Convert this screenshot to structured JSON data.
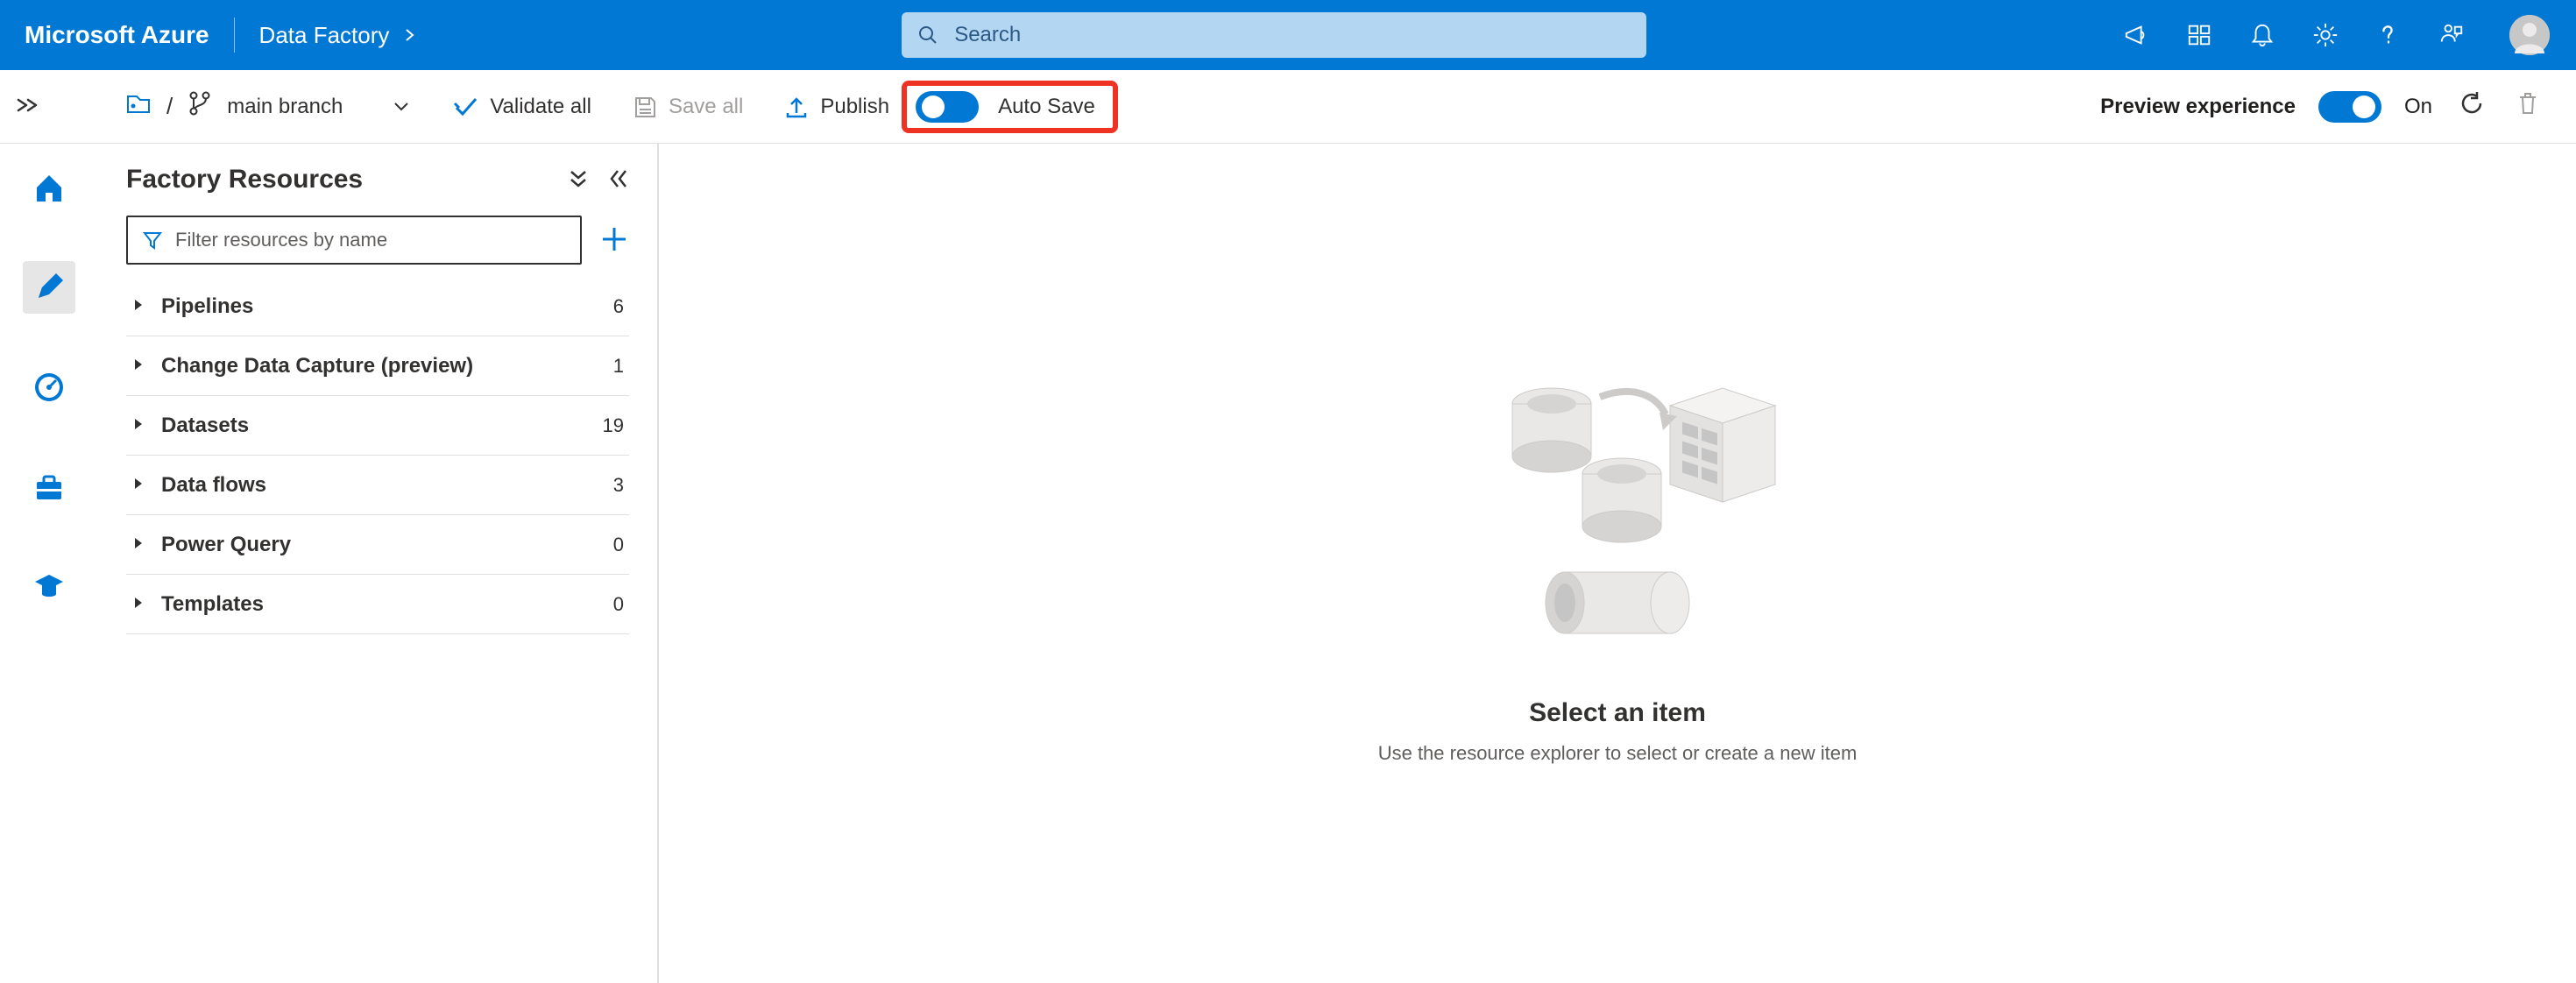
{
  "topbar": {
    "brand": "Microsoft Azure",
    "service": "Data Factory",
    "search_placeholder": "Search"
  },
  "toolbar": {
    "branch_name": "main branch",
    "validate_all": "Validate all",
    "save_all": "Save all",
    "publish": "Publish",
    "auto_save": "Auto Save",
    "preview_experience": "Preview experience",
    "preview_on": "On"
  },
  "resources": {
    "title": "Factory Resources",
    "filter_placeholder": "Filter resources by name",
    "items": [
      {
        "label": "Pipelines",
        "count": "6"
      },
      {
        "label": "Change Data Capture (preview)",
        "count": "1"
      },
      {
        "label": "Datasets",
        "count": "19"
      },
      {
        "label": "Data flows",
        "count": "3"
      },
      {
        "label": "Power Query",
        "count": "0"
      },
      {
        "label": "Templates",
        "count": "0"
      }
    ]
  },
  "main": {
    "title": "Select an item",
    "subtitle": "Use the resource explorer to select or create a new item"
  }
}
